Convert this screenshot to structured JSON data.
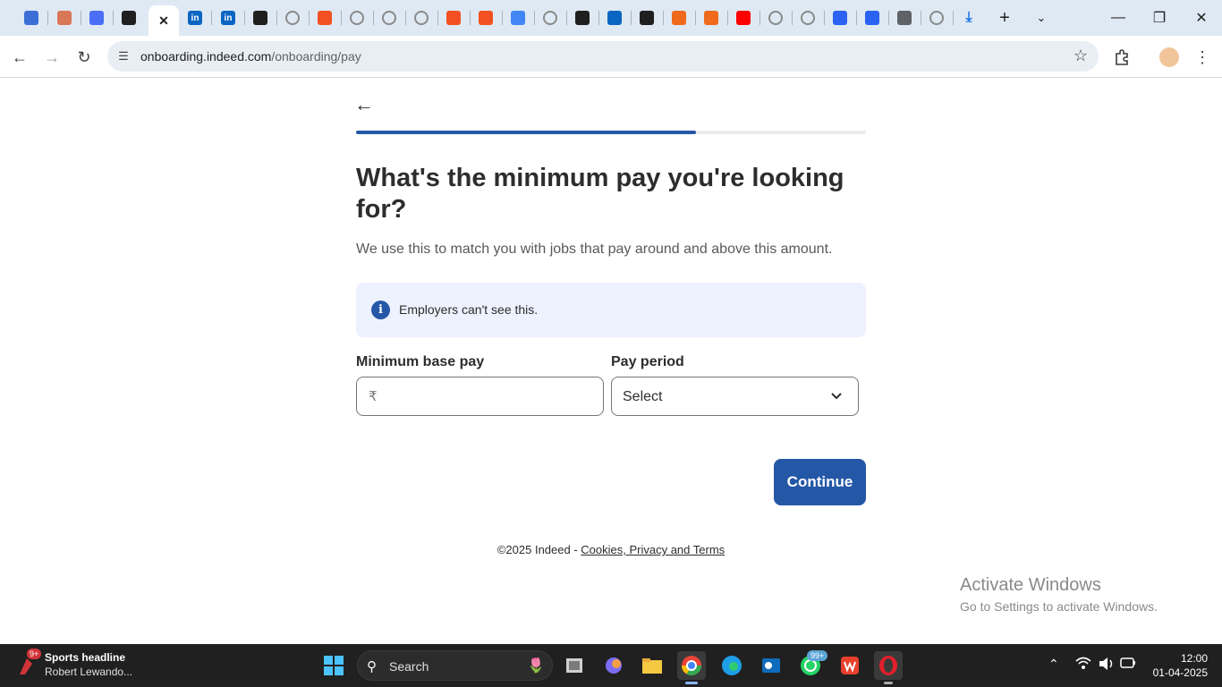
{
  "browser": {
    "tabs": [
      {
        "icon": "copilot-icon",
        "color": "#3b6fd6"
      },
      {
        "icon": "claude-icon",
        "color": "#d97757"
      },
      {
        "icon": "gemini-icon",
        "color": "#4a6ef5"
      },
      {
        "icon": "chatgpt-icon",
        "color": "#1f1f1f"
      },
      {
        "icon": "close-icon",
        "color": "#1f1f1f"
      },
      {
        "icon": "linkedin-icon",
        "color": "#0a66c2"
      },
      {
        "icon": "linkedin-icon",
        "color": "#0a66c2"
      },
      {
        "icon": "indeed-icon",
        "color": "#1f1f1f"
      },
      {
        "icon": "globe-icon",
        "color": "#8a8a8a"
      },
      {
        "icon": "microsoft-icon",
        "color": "#f25022"
      },
      {
        "icon": "globe-icon",
        "color": "#8a8a8a"
      },
      {
        "icon": "globe-icon",
        "color": "#8a8a8a"
      },
      {
        "icon": "globe-icon",
        "color": "#8a8a8a"
      },
      {
        "icon": "microsoft-icon",
        "color": "#f25022"
      },
      {
        "icon": "microsoft-icon",
        "color": "#f25022"
      },
      {
        "icon": "google-icon",
        "color": "#4285f4"
      },
      {
        "icon": "globe-icon",
        "color": "#8a8a8a"
      },
      {
        "icon": "indeed-icon",
        "color": "#1f1f1f"
      },
      {
        "icon": "butterfly-icon",
        "color": "#0a66c2"
      },
      {
        "icon": "anthropic-icon",
        "color": "#1f1f1f"
      },
      {
        "icon": "orange-app-icon",
        "color": "#f06a1d"
      },
      {
        "icon": "orange-app-icon",
        "color": "#f06a1d"
      },
      {
        "icon": "youtube-icon",
        "color": "#ff0000"
      },
      {
        "icon": "globe-icon",
        "color": "#8a8a8a"
      },
      {
        "icon": "globe-icon",
        "color": "#8a8a8a"
      },
      {
        "icon": "blue-k-icon",
        "color": "#2a62f2"
      },
      {
        "icon": "blue-k-icon",
        "color": "#2a62f2"
      },
      {
        "icon": "chrome-icon",
        "color": "#5f6368"
      },
      {
        "icon": "globe-icon",
        "color": "#8a8a8a"
      },
      {
        "icon": "download-icon",
        "color": "#1a73e8"
      }
    ],
    "url_host": "onboarding.indeed.com",
    "url_path": "/onboarding/pay"
  },
  "page": {
    "heading": "What's the minimum pay you're looking for?",
    "subtext": "We use this to match you with jobs that pay around and above this amount.",
    "info_text": "Employers can't see this.",
    "pay_label": "Minimum base pay",
    "currency_symbol": "₹",
    "pay_value": "",
    "period_label": "Pay period",
    "period_value": "Select",
    "continue_label": "Continue",
    "progress_fraction": 0.667,
    "footer_prefix": "©2025 Indeed - ",
    "footer_link": "Cookies, Privacy and Terms",
    "brand_color": "#2557a7"
  },
  "watermark": {
    "line1": "Activate Windows",
    "line2": "Go to Settings to activate Windows."
  },
  "taskbar": {
    "news_badge": "9+",
    "news_title": "Sports headline",
    "news_sub": "Robert Lewando...",
    "search_text": "Search",
    "whatsapp_badge": "99+",
    "time": "12:00",
    "date": "01-04-2025"
  }
}
